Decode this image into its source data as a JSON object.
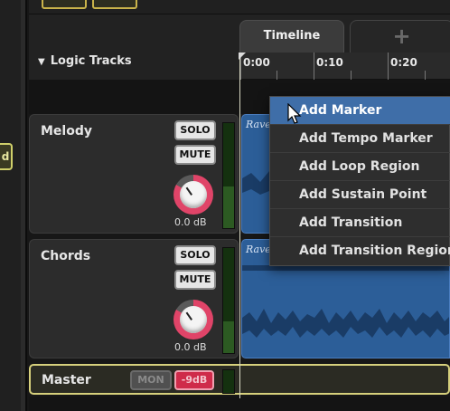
{
  "left_panel": {
    "tab_label": "d"
  },
  "tracks_header": {
    "title": "Logic Tracks"
  },
  "tabs": [
    {
      "label": "Timeline",
      "active": true
    },
    {
      "label": "+",
      "active": false
    }
  ],
  "ruler": {
    "ticks": [
      "0:00",
      "0:10",
      "0:20"
    ]
  },
  "tracks": [
    {
      "name": "Melody",
      "solo_label": "SOLO",
      "mute_label": "MUTE",
      "volume": "0.0 dB",
      "region_label": "Rave"
    },
    {
      "name": "Chords",
      "solo_label": "SOLO",
      "mute_label": "MUTE",
      "volume": "0.0 dB",
      "region_label": "Rave"
    }
  ],
  "master": {
    "name": "Master",
    "mon_label": "MON",
    "volume_label": "-9dB"
  },
  "context_menu": {
    "items": [
      {
        "label": "Add Marker",
        "highlighted": true
      },
      {
        "label": "Add Tempo Marker"
      },
      {
        "label": "Add Loop Region"
      },
      {
        "label": "Add Sustain Point"
      },
      {
        "label": "Add Transition"
      },
      {
        "label": "Add Transition Region"
      }
    ]
  },
  "colors": {
    "accent_pink": "#e04468",
    "region_blue": "#2c5e98",
    "menu_highlight": "#3f6ea8",
    "master_border": "#d6d07c"
  }
}
